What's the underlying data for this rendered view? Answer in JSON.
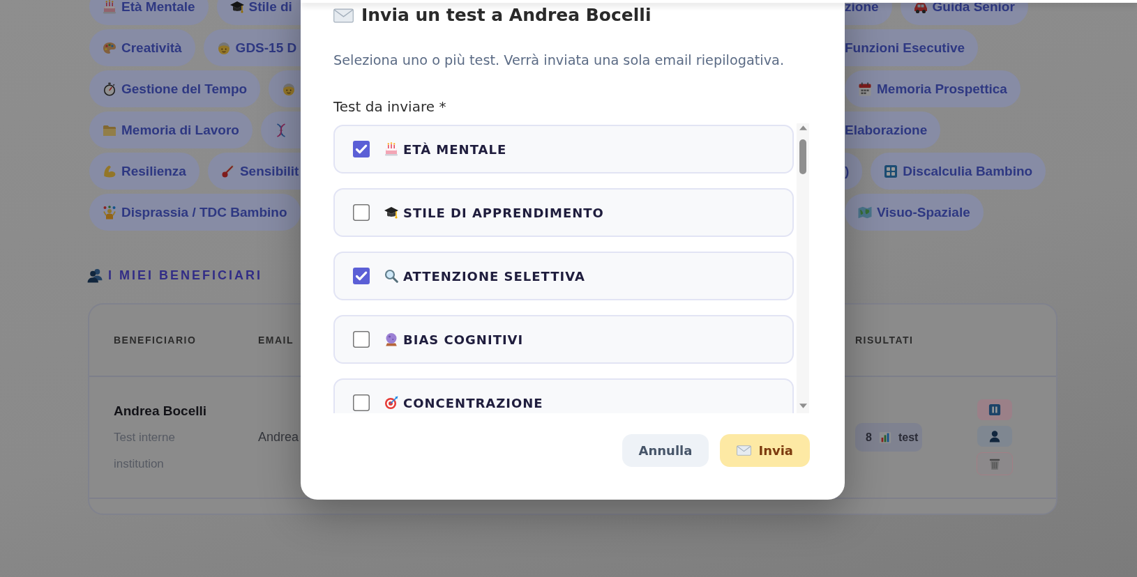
{
  "chip_rows": [
    {
      "left": [
        {
          "label": "Età Mentale",
          "partial": false
        },
        {
          "label": "Stile di",
          "partial": true
        }
      ],
      "right": [
        {
          "label": "zione",
          "partial": true
        },
        {
          "label": "Guida Senior",
          "partial": false
        }
      ]
    },
    {
      "left": [
        {
          "label": "Creatività",
          "partial": false
        },
        {
          "label": "GDS-15 D",
          "partial": true
        }
      ],
      "right": [
        {
          "label": "Funzioni Esecutive",
          "partial": true
        }
      ]
    },
    {
      "left": [
        {
          "label": "Gestione del Tempo",
          "partial": false
        },
        {
          "partial": true
        }
      ],
      "right": [
        {
          "label": "Memoria Prospettica",
          "partial": false
        }
      ]
    },
    {
      "left": [
        {
          "label": "Memoria di Lavoro",
          "partial": false
        },
        {
          "partial": true
        }
      ],
      "right": [
        {
          "label": "Elaborazione",
          "partial": true
        }
      ]
    },
    {
      "left": [
        {
          "label": "Resilienza",
          "partial": false
        },
        {
          "label": "Sensibilit",
          "partial": true
        }
      ],
      "right": [
        {
          "label": ")",
          "partial": true
        },
        {
          "label": "Discalculia Bambino",
          "partial": false
        }
      ]
    },
    {
      "left": [
        {
          "label": "Disprassia / TDC Bambino",
          "partial": false
        }
      ],
      "right": [
        {
          "label": "Visuo-Spaziale",
          "partial": false
        }
      ]
    }
  ],
  "section_title": "I MIEI BENEFICIARI",
  "table": {
    "columns": [
      "BENEFICIARIO",
      "EMAIL",
      "RISULTATI"
    ],
    "rows": [
      {
        "name": "Andrea Bocelli",
        "note": "Test interne",
        "category": "institution",
        "email": "Andrea",
        "results": {
          "count": "8",
          "unit": "test"
        }
      }
    ]
  },
  "modal": {
    "title": "Invia un test a Andrea Bocelli",
    "subtitle": "Seleziona uno o più test. Verrà inviata una sola email riepilogativa.",
    "field_label": "Test da inviare *",
    "tests": [
      {
        "label": "ETÀ MENTALE",
        "checked": true
      },
      {
        "label": "STILE DI APPRENDIMENTO",
        "checked": false
      },
      {
        "label": "ATTENZIONE SELETTIVA",
        "checked": true
      },
      {
        "label": "BIAS COGNITIVI",
        "checked": false
      },
      {
        "label": "CONCENTRAZIONE",
        "checked": false
      }
    ],
    "buttons": {
      "cancel": "Annulla",
      "submit": "Invia"
    }
  }
}
